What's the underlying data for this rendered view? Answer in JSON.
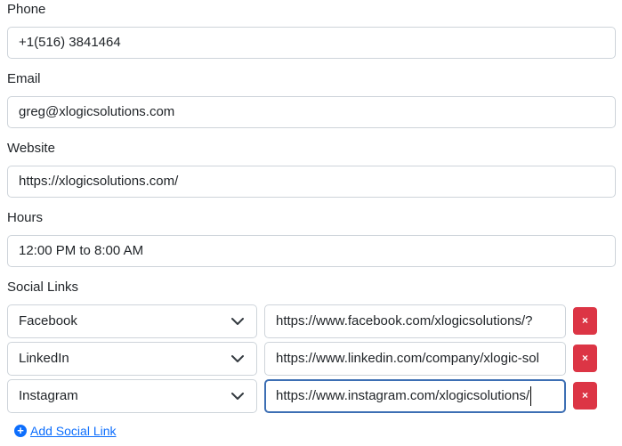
{
  "phone": {
    "label": "Phone",
    "value": "+1(516) 3841464"
  },
  "email": {
    "label": "Email",
    "value": "greg@xlogicsolutions.com"
  },
  "website": {
    "label": "Website",
    "value": "https://xlogicsolutions.com/"
  },
  "hours": {
    "label": "Hours",
    "value": "12:00 PM to 8:00 AM"
  },
  "social": {
    "label": "Social Links",
    "rows": [
      {
        "platform": "Facebook",
        "url": "https://www.facebook.com/xlogicsolutions/?",
        "remove": "×"
      },
      {
        "platform": "LinkedIn",
        "url": "https://www.linkedin.com/company/xlogic-sol",
        "remove": "×"
      },
      {
        "platform": "Instagram",
        "url": "https://www.instagram.com/xlogicsolutions/",
        "remove": "×"
      }
    ],
    "add_label": "Add Social Link",
    "add_icon": "+"
  },
  "colors": {
    "accent": "#0d6efd",
    "danger": "#dc3545",
    "focus_border": "#3d6fb4"
  }
}
